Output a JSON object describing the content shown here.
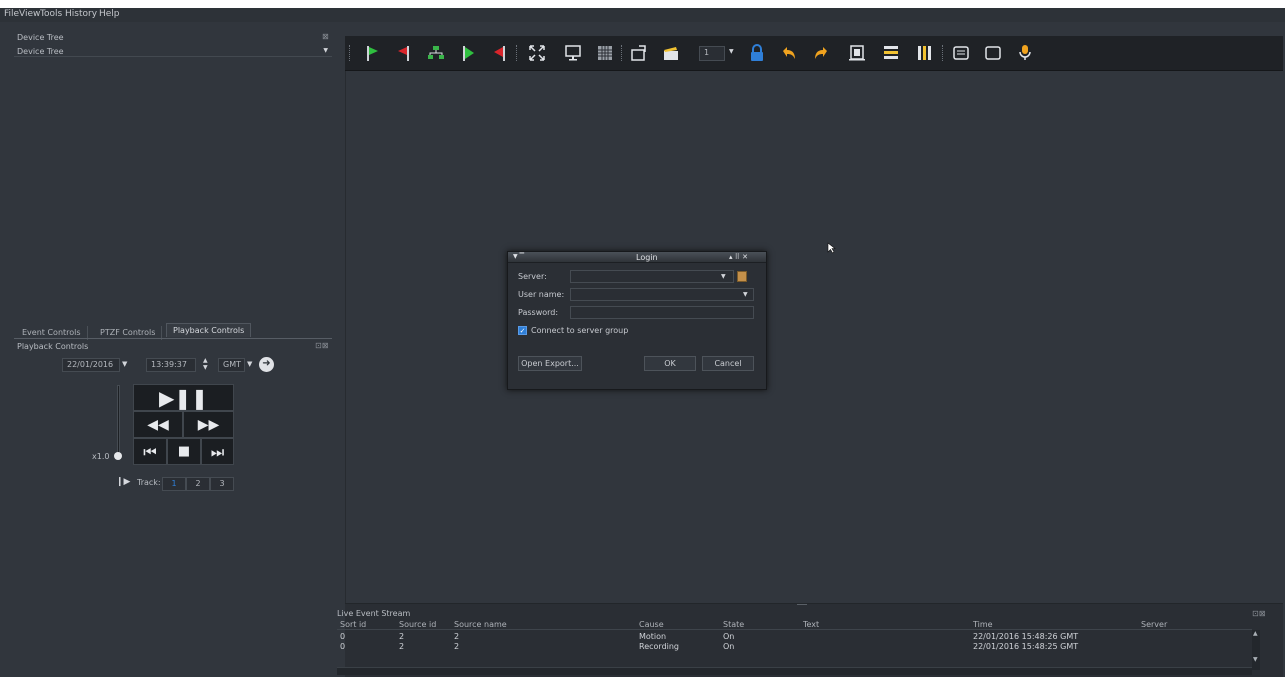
{
  "menu": [
    "File",
    "View",
    "Tools",
    "History",
    "Help"
  ],
  "device_tree": {
    "panel_title": "Device Tree",
    "combo_value": "Device Tree"
  },
  "tabs": [
    {
      "label": "Event Controls"
    },
    {
      "label": "PTZF Controls"
    },
    {
      "label": "Playback Controls"
    }
  ],
  "playback": {
    "panel_title": "Playback Controls",
    "date": "22/01/2016",
    "time": "13:39:37",
    "timezone": "GMT",
    "speed": "x1.0",
    "track_label": "Track:",
    "tracks": [
      "1",
      "2",
      "3"
    ]
  },
  "toolbar": {
    "stream_number": "1",
    "icons": [
      "play-green-icon",
      "stop-red-icon",
      "network-icon",
      "play-green-small-icon",
      "stop-red-small-icon",
      "fullscreen-icon",
      "monitor-icon",
      "grid-icon",
      "folder-open-icon",
      "clapper-icon",
      "lock-icon",
      "undo-arrow-icon",
      "redo-arrow-icon",
      "frame-icon",
      "list-icon",
      "columns-icon",
      "screen-icon",
      "screen-outline-icon",
      "microphone-icon"
    ]
  },
  "login": {
    "title": "Login",
    "server_label": "Server:",
    "username_label": "User name:",
    "password_label": "Password:",
    "server_value": "",
    "username_value": "",
    "password_value": "",
    "group_checkbox_label": "Connect to server group",
    "group_checked": true,
    "open_export": "Open Export...",
    "ok": "OK",
    "cancel": "Cancel"
  },
  "event_stream": {
    "title": "Live Event Stream",
    "columns": [
      "Sort id",
      "Source id",
      "Source name",
      "Cause",
      "State",
      "Text",
      "Time",
      "Server"
    ],
    "rows": [
      {
        "sort_id": "0",
        "source_id": "2",
        "source_name": "2",
        "cause": "Motion",
        "state": "On",
        "text": "",
        "time": "22/01/2016 15:48:26 GMT",
        "server": ""
      },
      {
        "sort_id": "0",
        "source_id": "2",
        "source_name": "2",
        "cause": "Recording",
        "state": "On",
        "text": "",
        "time": "22/01/2016 15:48:25 GMT",
        "server": ""
      }
    ]
  },
  "colors": {
    "background": "#31363d",
    "toolbar": "#1f2226",
    "accent_blue": "#2f7fd8",
    "green": "#2fbf3f",
    "red": "#d9252b"
  }
}
